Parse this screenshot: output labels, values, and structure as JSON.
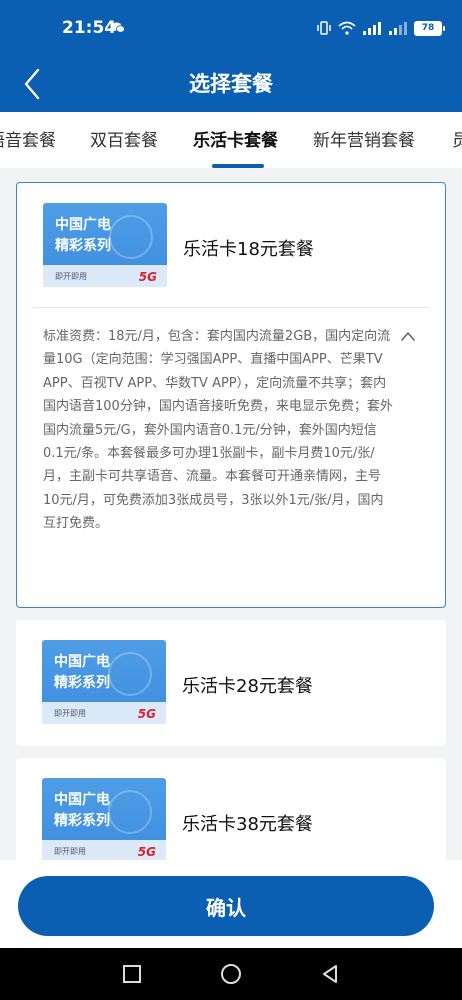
{
  "status_bar": {
    "time": "21:54",
    "battery": "78"
  },
  "header": {
    "title": "选择套餐"
  },
  "tabs": [
    {
      "label": "语音套餐"
    },
    {
      "label": "双百套餐"
    },
    {
      "label": "乐活卡套餐",
      "active": true
    },
    {
      "label": "新年营销套餐"
    },
    {
      "label": "员"
    }
  ],
  "plans": [
    {
      "thumb_title": "中国广电\n精彩系列",
      "thumb_sub": "即开即用",
      "thumb_badge": "5G",
      "name": "乐活卡18元套餐",
      "selected": true,
      "description": "标准资费：18元/月，包含：套内国内流量2GB，国内定向流量10G（定向范围：学习强国APP、直播中国APP、芒果TV APP、百视TV APP、华数TV APP），定向流量不共享；套内国内语音100分钟，国内语音接听免费，来电显示免费；套外国内流量5元/G，套外国内语音0.1元/分钟，套外国内短信0.1元/条。本套餐最多可办理1张副卡，副卡月费10元/张/月，主副卡可共享语音、流量。本套餐可开通亲情网，主号10元/月，可免费添加3张成员号，3张以外1元/张/月，国内互打免费。"
    },
    {
      "thumb_title": "中国广电\n精彩系列",
      "thumb_sub": "即开即用",
      "thumb_badge": "5G",
      "name": "乐活卡28元套餐",
      "selected": false
    },
    {
      "thumb_title": "中国广电\n精彩系列",
      "thumb_sub": "即开即用",
      "thumb_badge": "5G",
      "name": "乐活卡38元套餐",
      "selected": false
    }
  ],
  "confirm_label": "确认",
  "colors": {
    "primary": "#0b5fb3",
    "selected_border": "#3a86c8",
    "badge_5g": "#d7242f"
  },
  "icons": [
    "back-arrow-icon",
    "wechat-icon",
    "vibrate-icon",
    "wifi-icon",
    "signal-icon",
    "battery-icon",
    "collapse-chevron-up-icon",
    "square-nav-icon",
    "circle-nav-icon",
    "triangle-back-icon"
  ]
}
